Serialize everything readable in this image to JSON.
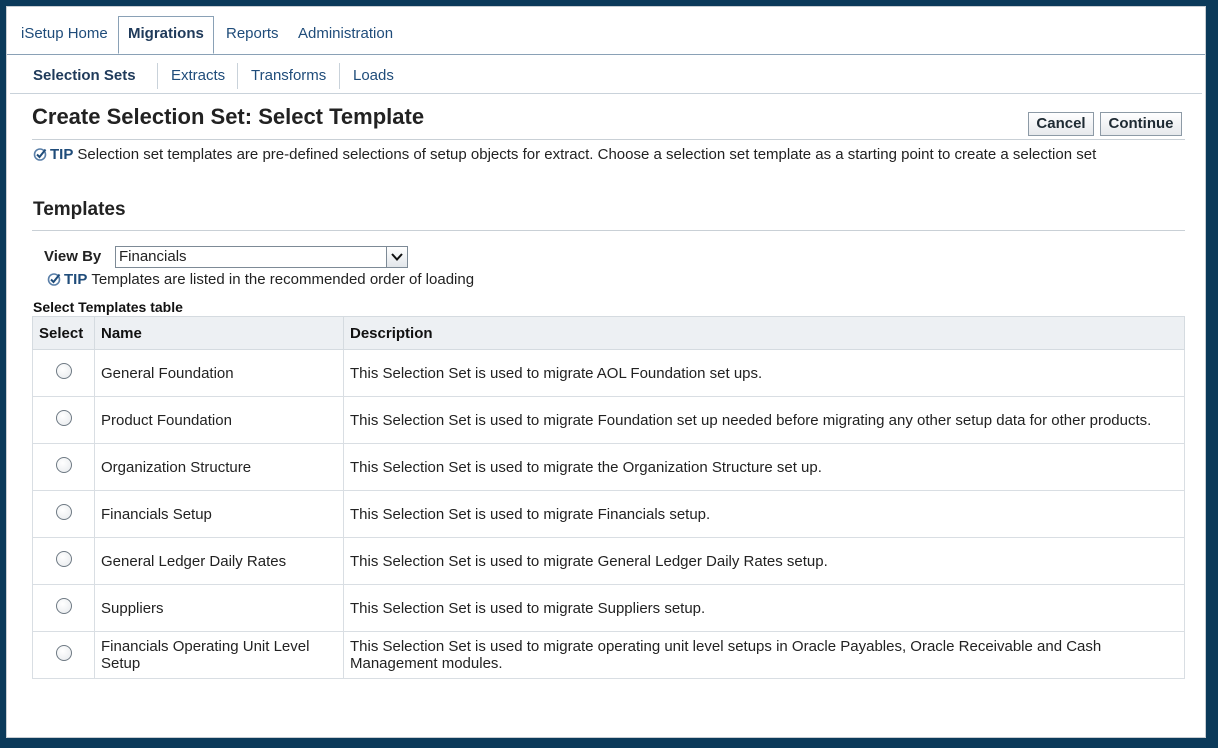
{
  "tabs": [
    {
      "label": "iSetup Home"
    },
    {
      "label": "Migrations"
    },
    {
      "label": "Reports"
    },
    {
      "label": "Administration"
    }
  ],
  "subtabs": [
    {
      "label": "Selection Sets"
    },
    {
      "label": "Extracts"
    },
    {
      "label": "Transforms"
    },
    {
      "label": "Loads"
    }
  ],
  "page": {
    "title": "Create Selection Set: Select Template",
    "cancel_label": "Cancel",
    "continue_label": "Continue",
    "tip_label": "TIP",
    "tip_text": "Selection set templates are pre-defined selections of setup objects for extract. Choose a selection set template as a starting point to create a selection set"
  },
  "templates": {
    "title": "Templates",
    "view_by_label": "View By",
    "view_by_value": "Financials",
    "tip_label": "TIP",
    "tip_text": "Templates are listed in the recommended order of loading",
    "table_caption": "Select Templates table",
    "columns": [
      "Select",
      "Name",
      "Description"
    ],
    "rows": [
      {
        "name": "General Foundation",
        "description": "This Selection Set is used to migrate AOL Foundation set ups."
      },
      {
        "name": "Product Foundation",
        "description": "This Selection Set is used to migrate Foundation set up needed before migrating any other setup data for other products."
      },
      {
        "name": "Organization Structure",
        "description": "This Selection Set is used to migrate the Organization Structure set up."
      },
      {
        "name": "Financials Setup",
        "description": "This Selection Set is used to migrate Financials setup."
      },
      {
        "name": "General Ledger Daily Rates",
        "description": "This Selection Set is used to migrate General Ledger Daily Rates setup."
      },
      {
        "name": "Suppliers",
        "description": "This Selection Set is used to migrate Suppliers setup."
      },
      {
        "name": "Financials Operating Unit Level Setup",
        "description": "This Selection Set is used to migrate operating unit level setups in Oracle Payables, Oracle Receivable and Cash Management modules."
      }
    ]
  },
  "colors": {
    "accent": "#1f4c7a",
    "outer_background": "#0b3a5a"
  }
}
